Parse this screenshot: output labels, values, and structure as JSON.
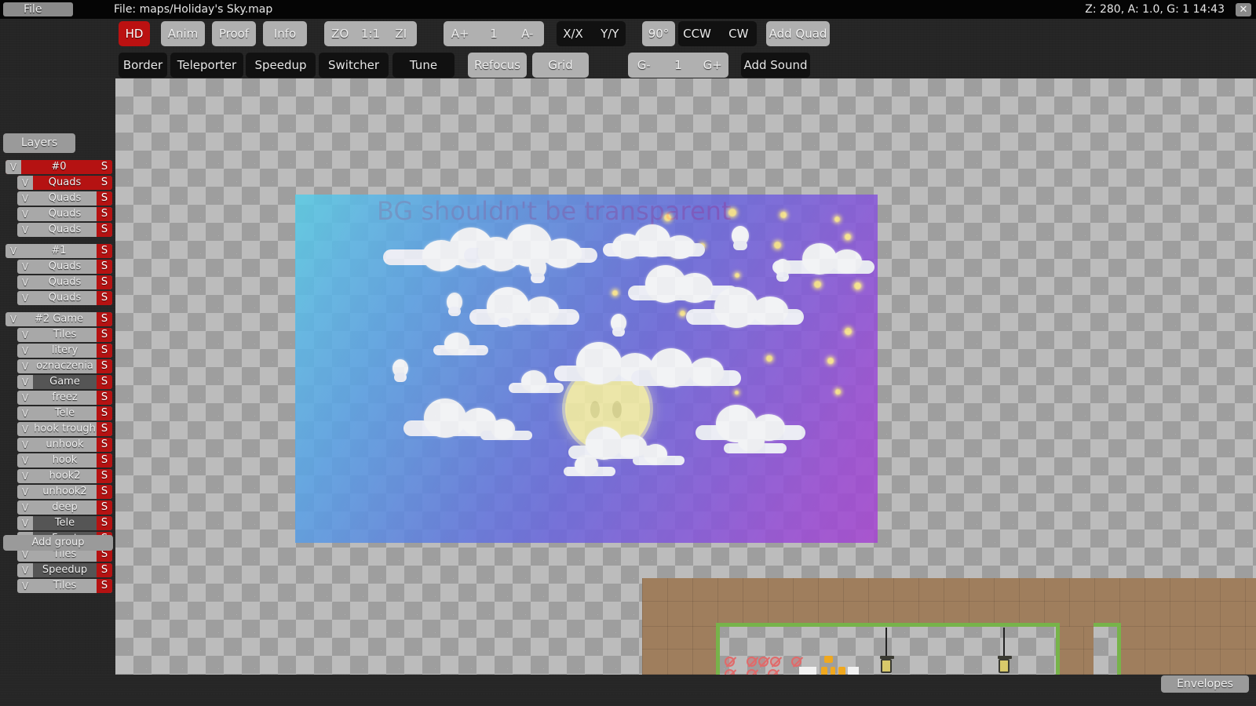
{
  "titlebar": {
    "file_menu": "File",
    "file_path": "File: maps/Holiday's Sky.map",
    "status": "Z: 280, A: 1.0, G: 1  14:43",
    "close": "✕"
  },
  "toolbar": {
    "row1": [
      {
        "label": "HD",
        "style": "active"
      },
      {
        "label": "Anim",
        "style": "light"
      },
      {
        "label": "Proof",
        "style": "light"
      },
      {
        "label": "Info",
        "style": "light"
      }
    ],
    "zoom_group": {
      "out": "ZO",
      "reset": "1:1",
      "in": "ZI"
    },
    "anim_group": {
      "plus": "A+",
      "value": "1",
      "minus": "A-"
    },
    "flip_group": {
      "x": "X/X",
      "y": "Y/Y"
    },
    "rot_value": "90°",
    "rot_group": {
      "ccw": "CCW",
      "cw": "CW"
    },
    "add_quad": "Add Quad",
    "row2": [
      {
        "label": "Border",
        "style": "dark"
      },
      {
        "label": "Teleporter",
        "style": "dark"
      },
      {
        "label": "Speedup",
        "style": "dark"
      },
      {
        "label": "Switcher",
        "style": "dark"
      },
      {
        "label": "Tune",
        "style": "dark"
      },
      {
        "label": "Refocus",
        "style": "light"
      },
      {
        "label": "Grid",
        "style": "light"
      }
    ],
    "grid_group": {
      "minus": "G-",
      "value": "1",
      "plus": "G+"
    },
    "add_sound": "Add Sound"
  },
  "sidebar": {
    "layers_button": "Layers",
    "add_group_button": "Add group",
    "visible_mark": "V",
    "solo_mark": "S",
    "rows": [
      {
        "label": "#0",
        "kind": "group",
        "state": "sel",
        "vis": "on",
        "gap": false
      },
      {
        "label": "Quads",
        "kind": "layer",
        "state": "sel",
        "vis": "on",
        "gap": false
      },
      {
        "label": "Quads",
        "kind": "layer",
        "state": "norm",
        "vis": "off",
        "gap": false
      },
      {
        "label": "Quads",
        "kind": "layer",
        "state": "norm",
        "vis": "off",
        "gap": false
      },
      {
        "label": "Quads",
        "kind": "layer",
        "state": "norm",
        "vis": "off",
        "gap": false
      },
      {
        "label": "#1",
        "kind": "group",
        "state": "norm",
        "vis": "off",
        "gap": true
      },
      {
        "label": "Quads",
        "kind": "layer",
        "state": "norm",
        "vis": "off",
        "gap": false
      },
      {
        "label": "Quads",
        "kind": "layer",
        "state": "norm",
        "vis": "off",
        "gap": false
      },
      {
        "label": "Quads",
        "kind": "layer",
        "state": "norm",
        "vis": "off",
        "gap": false
      },
      {
        "label": "#2 Game",
        "kind": "group",
        "state": "norm",
        "vis": "off",
        "gap": true
      },
      {
        "label": "Tiles",
        "kind": "layer",
        "state": "norm",
        "vis": "off",
        "gap": false
      },
      {
        "label": "litery",
        "kind": "layer",
        "state": "norm",
        "vis": "off",
        "gap": false
      },
      {
        "label": "oznaczenia",
        "kind": "layer",
        "state": "norm",
        "vis": "off",
        "gap": false
      },
      {
        "label": "Game",
        "kind": "layer",
        "state": "dim",
        "vis": "on",
        "gap": false
      },
      {
        "label": "freez",
        "kind": "layer",
        "state": "norm",
        "vis": "off",
        "gap": false
      },
      {
        "label": "Tele",
        "kind": "layer",
        "state": "norm",
        "vis": "off",
        "gap": false
      },
      {
        "label": "hook trough",
        "kind": "layer",
        "state": "norm",
        "vis": "off",
        "gap": false
      },
      {
        "label": "unhook",
        "kind": "layer",
        "state": "norm",
        "vis": "off",
        "gap": false
      },
      {
        "label": "hook",
        "kind": "layer",
        "state": "norm",
        "vis": "off",
        "gap": false
      },
      {
        "label": "hook2",
        "kind": "layer",
        "state": "norm",
        "vis": "off",
        "gap": false
      },
      {
        "label": "unhook2",
        "kind": "layer",
        "state": "norm",
        "vis": "off",
        "gap": false
      },
      {
        "label": "deep",
        "kind": "layer",
        "state": "norm",
        "vis": "off",
        "gap": false
      },
      {
        "label": "Tele",
        "kind": "layer",
        "state": "dim",
        "vis": "on",
        "gap": false
      },
      {
        "label": "Front",
        "kind": "layer",
        "state": "dim",
        "vis": "on",
        "gap": false
      },
      {
        "label": "Tiles",
        "kind": "layer",
        "state": "norm",
        "vis": "off",
        "gap": false
      },
      {
        "label": "Speedup",
        "kind": "layer",
        "state": "dim",
        "vis": "on",
        "gap": false
      },
      {
        "label": "Tiles",
        "kind": "layer",
        "state": "norm",
        "vis": "off",
        "gap": false
      }
    ]
  },
  "canvas": {
    "warning_text": "BG shouldn't be transparent",
    "warning_color": "#ff0000",
    "envelopes_button": "Envelopes"
  },
  "colors": {
    "accent_red": "#b51212",
    "active_red": "#bb1111",
    "panel_bg": "#262626",
    "button_light": "#b0b0b0",
    "button_dark": "#111111",
    "checker_light": "#bcbcbc",
    "checker_dark": "#9e9e9e",
    "moon": "#f4eea6",
    "dirt": "#9f7e5d",
    "grass": "#77b34a"
  }
}
